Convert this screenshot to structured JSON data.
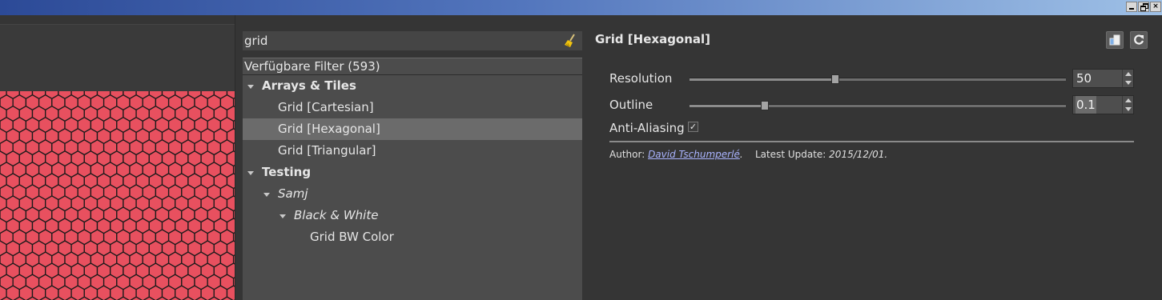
{
  "window": {
    "buttons": {
      "minimize": "",
      "maximize": "",
      "close": "×"
    }
  },
  "preview": {
    "fill_color": "#e8505f",
    "outline_color": "#1a1a1a"
  },
  "search": {
    "value": "grid",
    "clear_icon": "broom-icon"
  },
  "filter_list": {
    "header": "Verfügbare Filter (593)",
    "items": [
      {
        "label": "Arrays & Tiles",
        "style": "bold",
        "expanded": true,
        "level": 0
      },
      {
        "label": "Grid [Cartesian]",
        "style": "normal",
        "level": 1
      },
      {
        "label": "Grid [Hexagonal]",
        "style": "normal",
        "level": 1,
        "selected": true
      },
      {
        "label": "Grid [Triangular]",
        "style": "normal",
        "level": 1
      },
      {
        "label": "Testing",
        "style": "bold",
        "expanded": true,
        "level": 0
      },
      {
        "label": "Samj",
        "style": "italic",
        "expanded": true,
        "level": 1
      },
      {
        "label": "Black & White",
        "style": "italic",
        "expanded": true,
        "level": 2
      },
      {
        "label": "Grid BW Color",
        "style": "normal",
        "level": 3
      }
    ]
  },
  "filter_panel": {
    "title": "Grid [Hexagonal]",
    "toolbar_icons": [
      "copy-icon",
      "reset-icon"
    ],
    "params": [
      {
        "label": "Resolution",
        "value": "50",
        "fraction": 0.388
      },
      {
        "label": "Outline",
        "value": "0.1",
        "fraction": 0.2
      }
    ],
    "antialiasing": {
      "label": "Anti-Aliasing",
      "checked": true,
      "mark": "✓"
    },
    "author_prefix": "Author:",
    "author_name": "David Tschumperlé",
    "author_suffix": ".",
    "update_prefix": "Latest Update:",
    "update_date": "2015/12/01",
    "update_suffix": "."
  }
}
